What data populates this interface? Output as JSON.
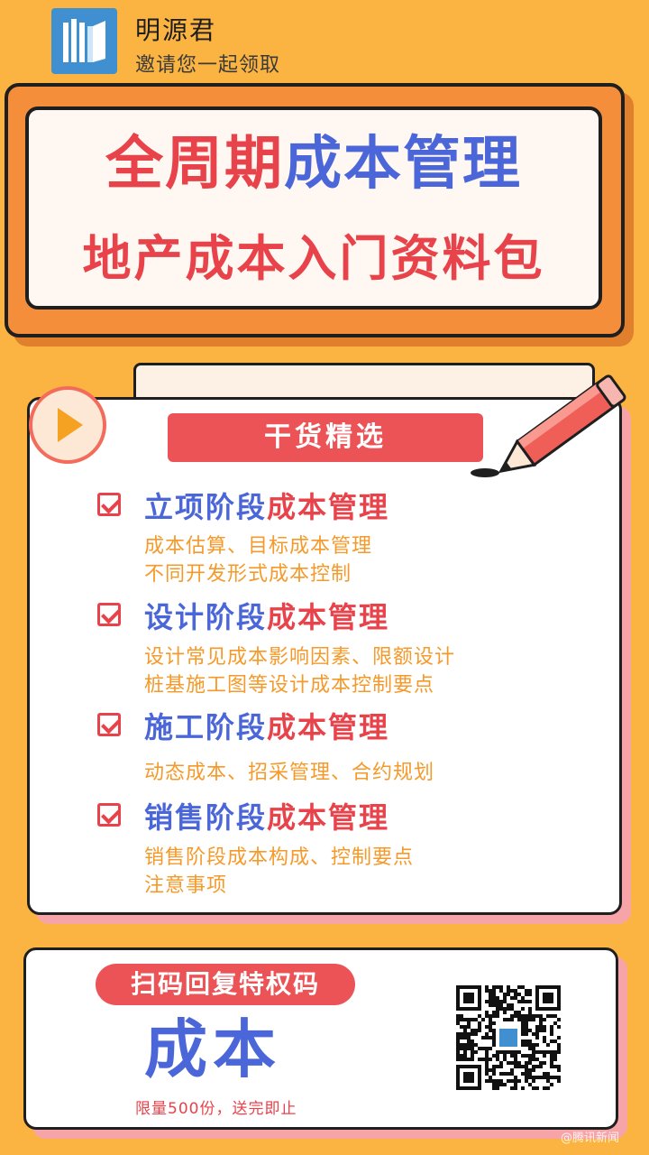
{
  "header": {
    "logo_icon": "book-stack-icon",
    "brand_name": "明源君",
    "subtitle": "邀请您一起领取"
  },
  "title_card": {
    "line1_red": "全周期",
    "line1_blue": "成本管理",
    "line2": "地产成本入门资料包"
  },
  "content": {
    "header_label": "干货精选",
    "items": [
      {
        "title_blue": "立项阶段",
        "title_red": "成本管理",
        "desc": [
          "成本估算、目标成本管理",
          "不同开发形式成本控制"
        ]
      },
      {
        "title_blue": "设计阶段",
        "title_red": "成本管理",
        "desc": [
          "设计常见成本影响因素、限额设计",
          "桩基施工图等设计成本控制要点"
        ]
      },
      {
        "title_blue": "施工阶段",
        "title_red": "成本管理",
        "desc": [
          "动态成本、招采管理、合约规划"
        ]
      },
      {
        "title_blue": "销售阶段",
        "title_red": "成本管理",
        "desc": [
          "销售阶段成本构成、控制要点",
          "注意事项"
        ]
      }
    ]
  },
  "bottom": {
    "scan_label": "扫码回复特权码",
    "code_word": "成本",
    "limit_note": "限量500份，送完即止",
    "qr_icon": "qr-code-icon"
  },
  "watermark": "@腾讯新闻",
  "colors": {
    "background": "#fbb441",
    "accent_red": "#e8424a",
    "accent_blue": "#4a66d8",
    "desc_orange": "#f59a2a"
  }
}
